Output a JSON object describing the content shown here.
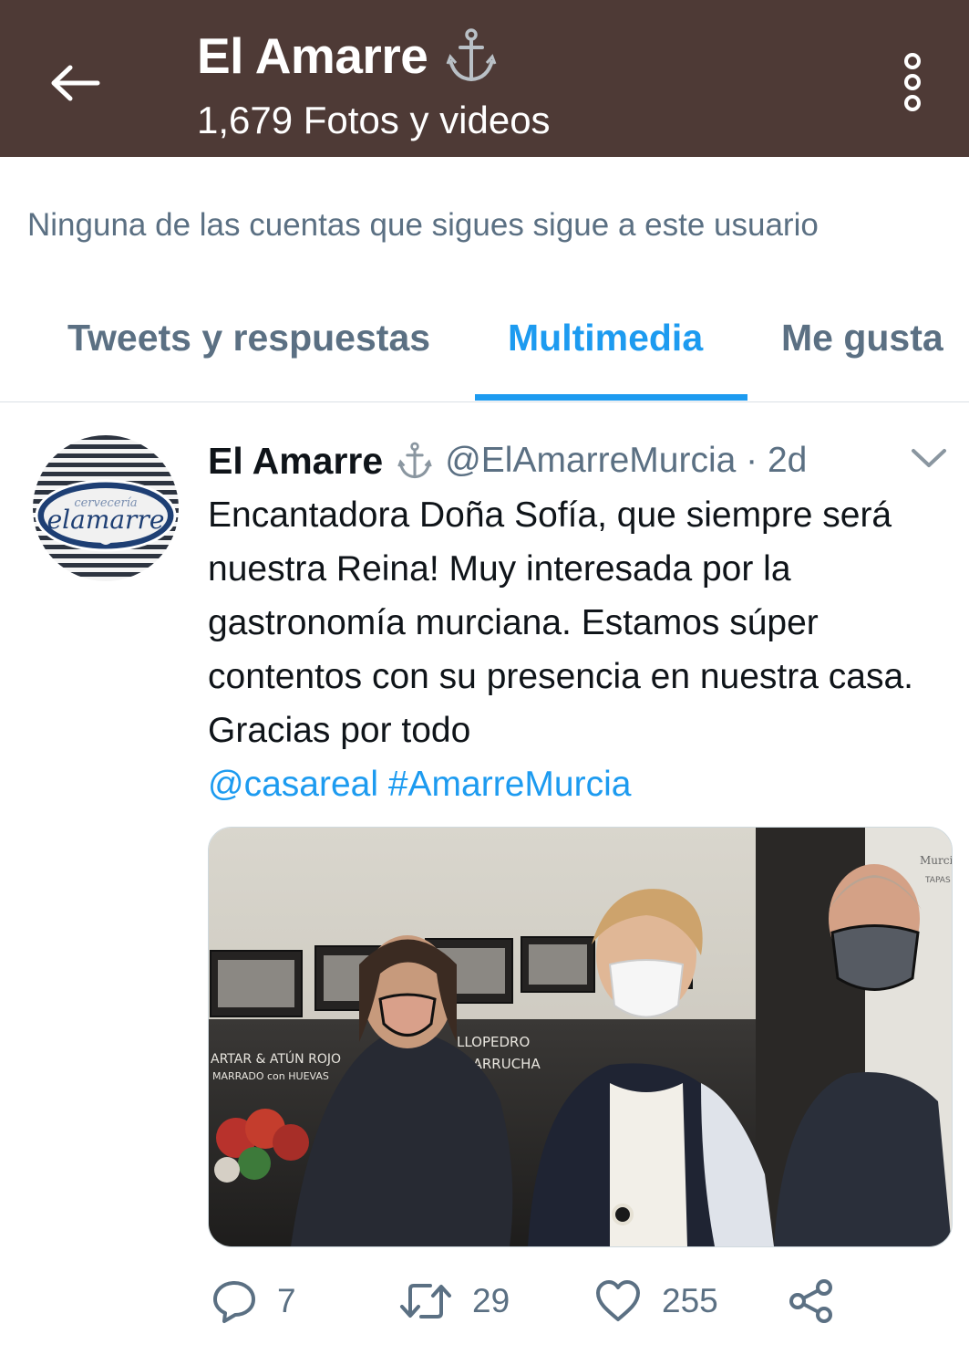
{
  "header": {
    "title": "El Amarre",
    "title_emoji_icon": "anchor-icon",
    "subtitle": "1,679 Fotos y videos",
    "background_color": "#4e3a36"
  },
  "follow_note": "Ninguna de las cuentas que sigues sigue a este usuario",
  "tabs": [
    {
      "label": "Tweets y respuestas",
      "active": false
    },
    {
      "label": "Multimedia",
      "active": true
    },
    {
      "label": "Me gusta",
      "active": false
    }
  ],
  "tweet": {
    "display_name": "El Amarre",
    "handle_time": "@ElAmarreMurcia · 2d",
    "text": "Encantadora Doña Sofía, que siempre será nuestra Reina! Muy interesada por la gastronomía murciana. Estamos súper contentos con su presencia en nuestra casa. Gracias por todo",
    "mention": "@casareal",
    "hashtag": "#AmarreMurcia",
    "avatar_text": {
      "line1": "cervecería",
      "line2": "elamarre"
    },
    "media_signs": {
      "left_line1": "ARTAR & ATÚN ROJO",
      "left_line2": "MARRADO con HUEVAS",
      "center_line1": "LLOPEDRO",
      "center_line2": "GARRUCHA",
      "right_line1": "Murcia",
      "right_line2": "TAPAS"
    },
    "actions": {
      "replies": "7",
      "retweets": "29",
      "likes": "255"
    }
  },
  "colors": {
    "accent": "#1d9bf0",
    "secondary_text": "#5b7083",
    "primary_text": "#0f1419"
  }
}
